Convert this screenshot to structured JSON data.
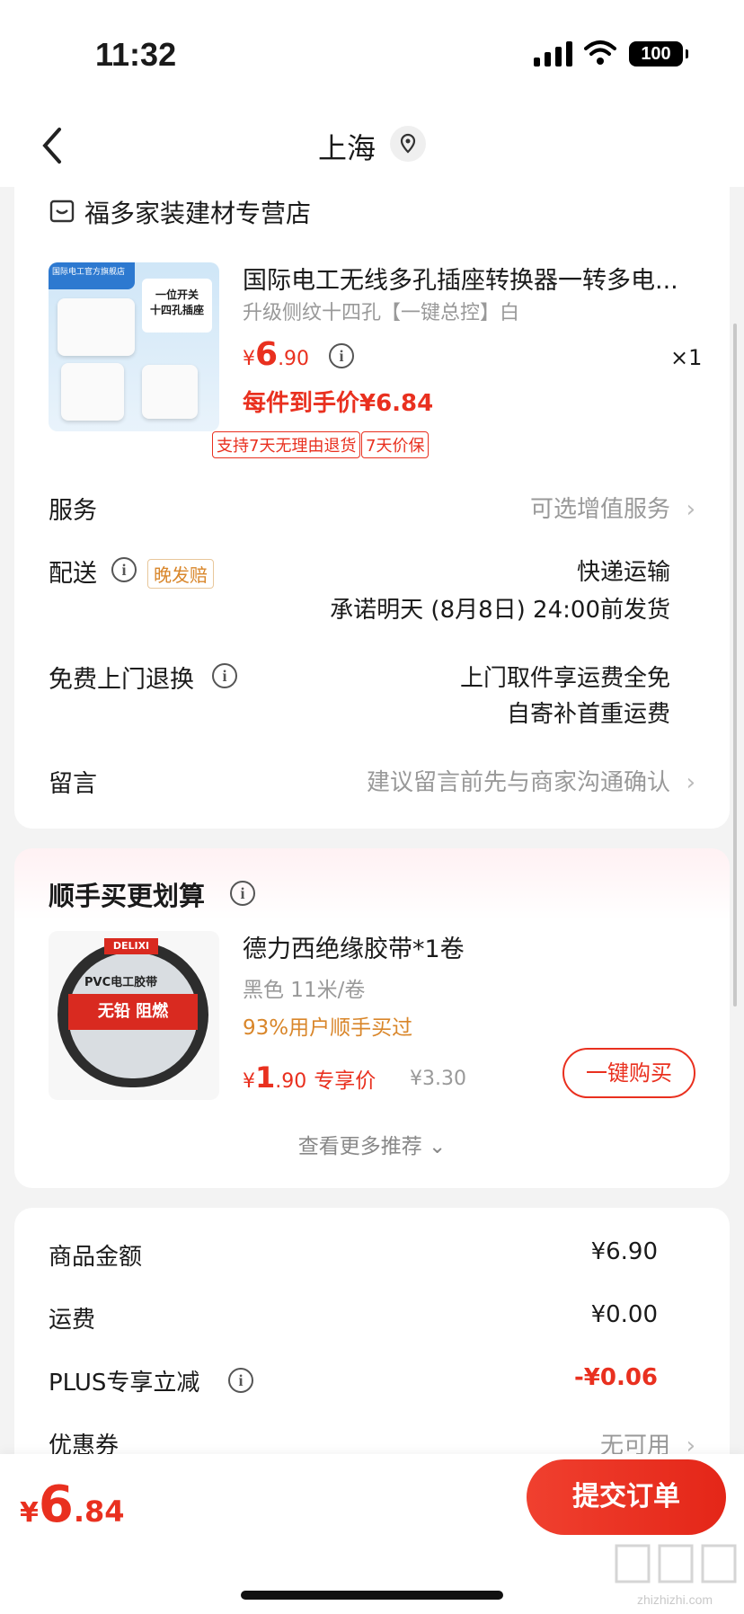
{
  "status": {
    "time": "11:32",
    "battery": "100"
  },
  "nav": {
    "title": "上海"
  },
  "store": {
    "name": "福多家装建材专营店"
  },
  "product": {
    "image_tag": "国际电工官方旗舰店",
    "image_box": [
      "一位开关",
      "十四孔插座"
    ],
    "title": "国际电工无线多孔插座转换器一转多电...",
    "spec": "升级侧纹十四孔【一键总控】白",
    "price_cur": "¥",
    "price_int": "6",
    "price_dec": ".90",
    "qty": "×1",
    "final_price": "每件到手价¥6.84",
    "badges": [
      "支持7天无理由退货",
      "7天价保"
    ]
  },
  "rows": {
    "service_label": "服务",
    "service_value": "可选增值服务",
    "delivery_label": "配送",
    "delivery_badge": "晚发赔",
    "delivery_value1": "快递运输",
    "delivery_value2": "承诺明天 (8月8日) 24:00前发货",
    "return_label": "免费上门退换",
    "return_value1": "上门取件享运费全免",
    "return_value2": "自寄补首重运费",
    "message_label": "留言",
    "message_value": "建议留言前先与商家沟通确认"
  },
  "recommend": {
    "title": "顺手买更划算",
    "tape_logo": "DELIXI",
    "tape_label": "PVC电工胶带",
    "tape_band": "无铅 阻燃",
    "item_title": "德力西绝缘胶带*1卷",
    "item_spec": "黑色 11米/卷",
    "item_social": "93%用户顺手买过",
    "price_cur": "¥",
    "price_int": "1",
    "price_dec": ".90",
    "price_label": "专享价",
    "orig_price": "¥3.30",
    "buy_label": "一键购买",
    "more_label": "查看更多推荐"
  },
  "summary": {
    "goods_label": "商品金额",
    "goods_value": "¥6.90",
    "shipping_label": "运费",
    "shipping_value": "¥0.00",
    "plus_label": "PLUS专享立减",
    "plus_value": "-¥0.06",
    "coupon_label": "优惠券",
    "coupon_value": "无可用"
  },
  "bottom": {
    "total_cur": "¥",
    "total_int": "6",
    "total_dec": ".84",
    "submit_label": "提交订单"
  },
  "watermark": "zhizhizhi.com",
  "colors": {
    "accent": "#e9301f",
    "orange": "#d9862a",
    "bg": "#f3f3f3"
  }
}
